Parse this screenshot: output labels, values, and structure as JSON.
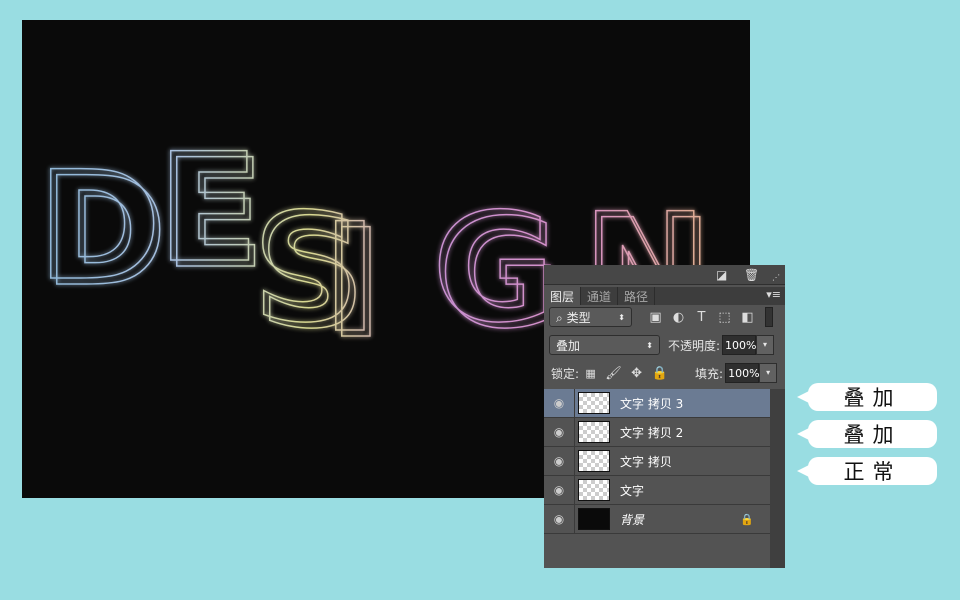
{
  "artwork": {
    "text": "DESIGN",
    "colors": [
      "#8fb8d8",
      "#a8c0e0",
      "#d8d890",
      "#c890d0",
      "#d890c8",
      "#e0b090"
    ]
  },
  "panel": {
    "tabs": [
      {
        "label": "图层",
        "active": true
      },
      {
        "label": "通道"
      },
      {
        "label": "路径"
      }
    ],
    "filter": {
      "label": "类型"
    },
    "blend_mode": "叠加",
    "opacity_label": "不透明度:",
    "opacity": "100%",
    "lock_label": "锁定:",
    "fill_label": "填充:",
    "fill": "100%",
    "layers": [
      {
        "name": "文字 拷贝 3",
        "selected": true
      },
      {
        "name": "文字 拷贝 2"
      },
      {
        "name": "文字 拷贝"
      },
      {
        "name": "文字"
      },
      {
        "name": "背景",
        "locked": true
      }
    ]
  },
  "callouts": [
    "叠加",
    "叠加",
    "正常"
  ]
}
